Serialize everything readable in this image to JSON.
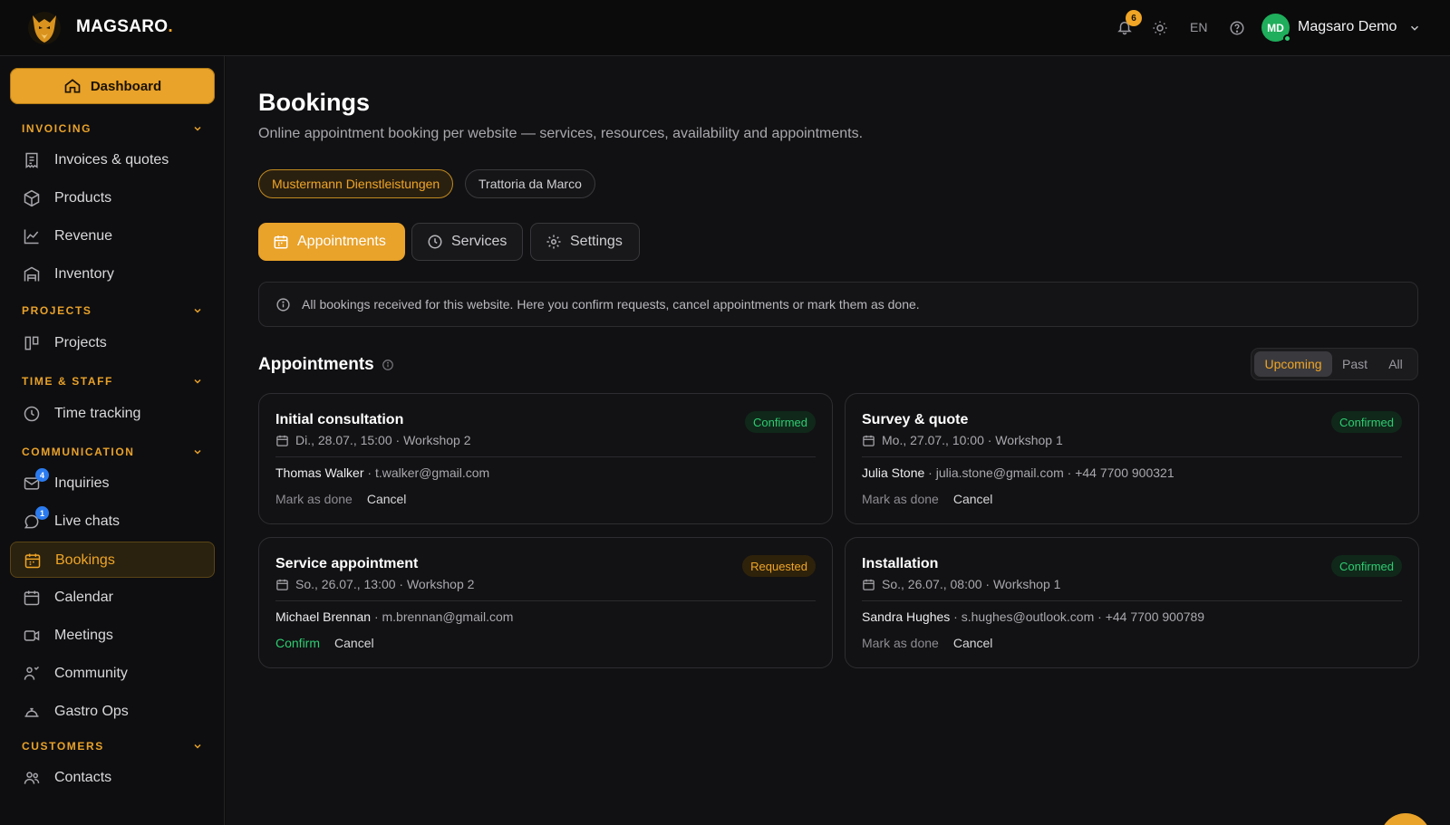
{
  "brand": {
    "name": "MAGSARO",
    "dot": "."
  },
  "header": {
    "notifications_count": "6",
    "language": "EN",
    "user_initials": "MD",
    "user_name": "Magsaro Demo"
  },
  "sidebar": {
    "dashboard": "Dashboard",
    "sections": {
      "invoicing": "INVOICING",
      "projects": "PROJECTS",
      "time_staff": "TIME & STAFF",
      "communication": "COMMUNICATION",
      "customers": "CUSTOMERS"
    },
    "items": {
      "invoices": "Invoices & quotes",
      "products": "Products",
      "revenue": "Revenue",
      "inventory": "Inventory",
      "projects": "Projects",
      "time_tracking": "Time tracking",
      "inquiries": "Inquiries",
      "inquiries_badge": "4",
      "live_chats": "Live chats",
      "live_chats_badge": "1",
      "bookings": "Bookings",
      "calendar": "Calendar",
      "meetings": "Meetings",
      "community": "Community",
      "gastro_ops": "Gastro Ops",
      "contacts": "Contacts"
    }
  },
  "page": {
    "title": "Bookings",
    "subtitle": "Online appointment booking per website — services, resources, availability and appointments.",
    "sites": [
      "Mustermann Dienstleistungen",
      "Trattoria da Marco"
    ],
    "tabs": [
      "Appointments",
      "Services",
      "Settings"
    ],
    "info": "All bookings received for this website. Here you confirm requests, cancel appointments or mark them as done.",
    "section_title": "Appointments",
    "filters": [
      "Upcoming",
      "Past",
      "All"
    ]
  },
  "appointments": [
    {
      "title": "Initial consultation",
      "meta": "Di., 28.07., 15:00 · Workshop 2",
      "name": "Thomas Walker",
      "contact": " · t.walker@gmail.com",
      "status": "Confirmed",
      "primary_action": "Mark as done",
      "cancel": "Cancel"
    },
    {
      "title": "Survey & quote",
      "meta": "Mo., 27.07., 10:00 · Workshop 1",
      "name": "Julia Stone",
      "contact": " · julia.stone@gmail.com · +44 7700 900321",
      "status": "Confirmed",
      "primary_action": "Mark as done",
      "cancel": "Cancel"
    },
    {
      "title": "Service appointment",
      "meta": "So., 26.07., 13:00 · Workshop 2",
      "name": "Michael Brennan",
      "contact": " · m.brennan@gmail.com",
      "status": "Requested",
      "primary_action": "Confirm",
      "cancel": "Cancel"
    },
    {
      "title": "Installation",
      "meta": "So., 26.07., 08:00 · Workshop 1",
      "name": "Sandra Hughes",
      "contact": " · s.hughes@outlook.com · +44 7700 900789",
      "status": "Confirmed",
      "primary_action": "Mark as done",
      "cancel": "Cancel"
    }
  ],
  "colors": {
    "accent": "#e9a22a",
    "confirmed": "#2ecc71",
    "background": "#111113"
  }
}
